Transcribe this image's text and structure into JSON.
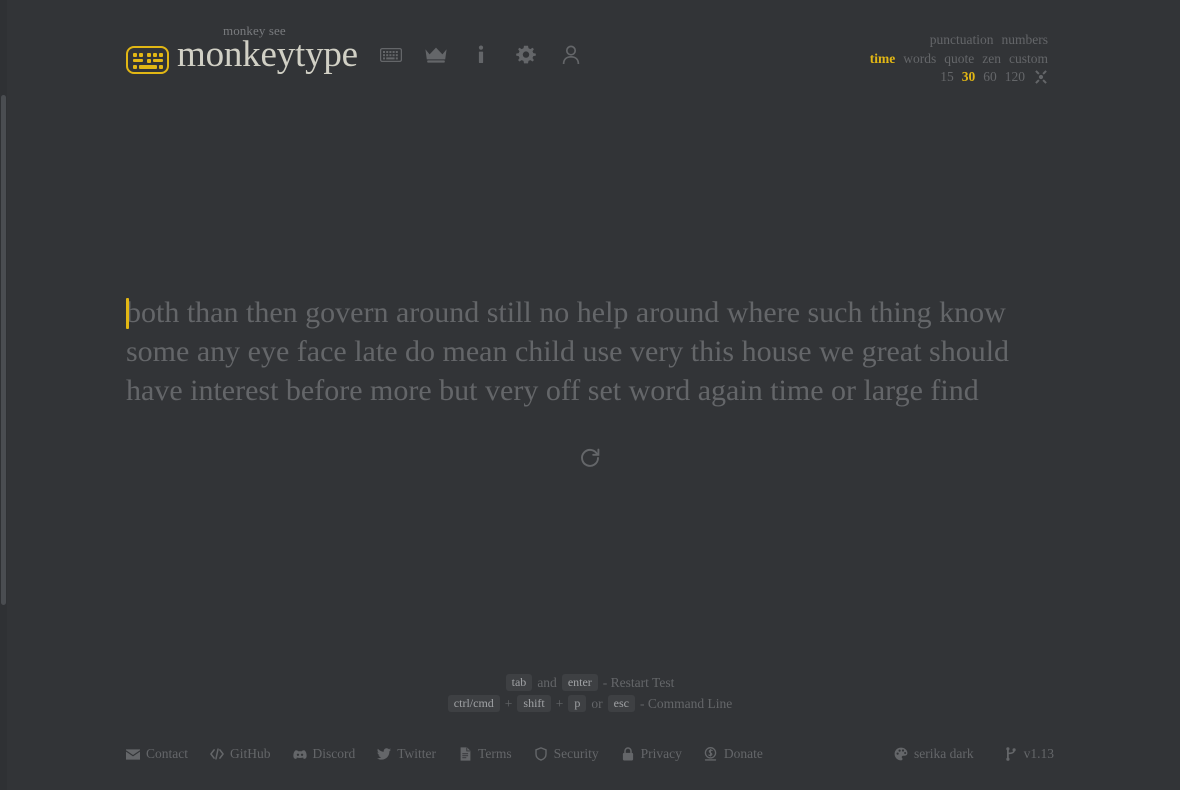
{
  "app": {
    "name": "monkeytype",
    "tagline": "monkey see",
    "background_color": "#323437",
    "accent_color": "#e2b714",
    "text_color": "#646669",
    "bright_text_color": "#d1d0c5"
  },
  "nav": [
    {
      "name": "keyboard-icon",
      "label": "keyboard"
    },
    {
      "name": "crown-icon",
      "label": "leaderboards"
    },
    {
      "name": "info-icon",
      "label": "about"
    },
    {
      "name": "gear-icon",
      "label": "settings"
    },
    {
      "name": "user-icon",
      "label": "account"
    }
  ],
  "config": {
    "row1": [
      {
        "label": "punctuation",
        "active": false
      },
      {
        "label": "numbers",
        "active": false
      }
    ],
    "row2": [
      {
        "label": "time",
        "active": true
      },
      {
        "label": "words",
        "active": false
      },
      {
        "label": "quote",
        "active": false
      },
      {
        "label": "zen",
        "active": false
      },
      {
        "label": "custom",
        "active": false
      }
    ],
    "row3": [
      {
        "label": "15",
        "active": false
      },
      {
        "label": "30",
        "active": true
      },
      {
        "label": "60",
        "active": false
      },
      {
        "label": "120",
        "active": false
      }
    ],
    "tools_icon": "wrench-icon"
  },
  "typing": {
    "lines": [
      [
        "both",
        "than",
        "then",
        "govern",
        "around",
        "still",
        "no",
        "help",
        "around",
        "where",
        "such",
        "thing",
        "know"
      ],
      [
        "some",
        "any",
        "eye",
        "face",
        "late",
        "do",
        "mean",
        "child",
        "use",
        "very",
        "this",
        "house",
        "we",
        "great",
        "should"
      ],
      [
        "have",
        "interest",
        "before",
        "more",
        "but",
        "very",
        "off",
        "set",
        "word",
        "again",
        "time",
        "or",
        "large",
        "find"
      ]
    ],
    "caret_position": "start-of-first-word",
    "restart_icon": "restart-icon"
  },
  "keytips": {
    "line1": {
      "key1": "tab",
      "conjunction": "and",
      "key2": "enter",
      "action": "- Restart Test"
    },
    "line2": {
      "key1": "ctrl/cmd",
      "plus1": "+",
      "key2": "shift",
      "plus2": "+",
      "key3": "p",
      "conjunction": "or",
      "key4": "esc",
      "action": "- Command Line"
    }
  },
  "footer": {
    "links": [
      {
        "label": "Contact",
        "icon": "envelope-icon"
      },
      {
        "label": "GitHub",
        "icon": "code-icon"
      },
      {
        "label": "Discord",
        "icon": "discord-icon"
      },
      {
        "label": "Twitter",
        "icon": "twitter-icon"
      },
      {
        "label": "Terms",
        "icon": "file-icon"
      },
      {
        "label": "Security",
        "icon": "shield-icon"
      },
      {
        "label": "Privacy",
        "icon": "lock-icon"
      },
      {
        "label": "Donate",
        "icon": "coin-icon"
      }
    ],
    "theme": {
      "label": "serika dark",
      "icon": "palette-icon"
    },
    "version": {
      "label": "v1.13",
      "icon": "code-branch-icon"
    }
  }
}
